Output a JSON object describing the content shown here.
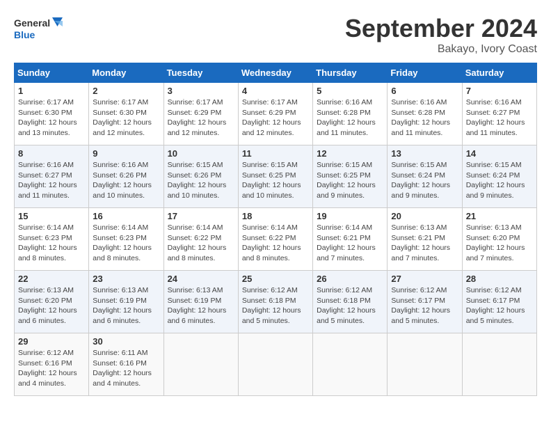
{
  "header": {
    "logo_line1": "General",
    "logo_line2": "Blue",
    "month_title": "September 2024",
    "location": "Bakayo, Ivory Coast"
  },
  "weekdays": [
    "Sunday",
    "Monday",
    "Tuesday",
    "Wednesday",
    "Thursday",
    "Friday",
    "Saturday"
  ],
  "weeks": [
    [
      {
        "day": 1,
        "sunrise": "6:17 AM",
        "sunset": "6:30 PM",
        "daylight": "12 hours and 13 minutes."
      },
      {
        "day": 2,
        "sunrise": "6:17 AM",
        "sunset": "6:30 PM",
        "daylight": "12 hours and 12 minutes."
      },
      {
        "day": 3,
        "sunrise": "6:17 AM",
        "sunset": "6:29 PM",
        "daylight": "12 hours and 12 minutes."
      },
      {
        "day": 4,
        "sunrise": "6:17 AM",
        "sunset": "6:29 PM",
        "daylight": "12 hours and 12 minutes."
      },
      {
        "day": 5,
        "sunrise": "6:16 AM",
        "sunset": "6:28 PM",
        "daylight": "12 hours and 11 minutes."
      },
      {
        "day": 6,
        "sunrise": "6:16 AM",
        "sunset": "6:28 PM",
        "daylight": "12 hours and 11 minutes."
      },
      {
        "day": 7,
        "sunrise": "6:16 AM",
        "sunset": "6:27 PM",
        "daylight": "12 hours and 11 minutes."
      }
    ],
    [
      {
        "day": 8,
        "sunrise": "6:16 AM",
        "sunset": "6:27 PM",
        "daylight": "12 hours and 11 minutes."
      },
      {
        "day": 9,
        "sunrise": "6:16 AM",
        "sunset": "6:26 PM",
        "daylight": "12 hours and 10 minutes."
      },
      {
        "day": 10,
        "sunrise": "6:15 AM",
        "sunset": "6:26 PM",
        "daylight": "12 hours and 10 minutes."
      },
      {
        "day": 11,
        "sunrise": "6:15 AM",
        "sunset": "6:25 PM",
        "daylight": "12 hours and 10 minutes."
      },
      {
        "day": 12,
        "sunrise": "6:15 AM",
        "sunset": "6:25 PM",
        "daylight": "12 hours and 9 minutes."
      },
      {
        "day": 13,
        "sunrise": "6:15 AM",
        "sunset": "6:24 PM",
        "daylight": "12 hours and 9 minutes."
      },
      {
        "day": 14,
        "sunrise": "6:15 AM",
        "sunset": "6:24 PM",
        "daylight": "12 hours and 9 minutes."
      }
    ],
    [
      {
        "day": 15,
        "sunrise": "6:14 AM",
        "sunset": "6:23 PM",
        "daylight": "12 hours and 8 minutes."
      },
      {
        "day": 16,
        "sunrise": "6:14 AM",
        "sunset": "6:23 PM",
        "daylight": "12 hours and 8 minutes."
      },
      {
        "day": 17,
        "sunrise": "6:14 AM",
        "sunset": "6:22 PM",
        "daylight": "12 hours and 8 minutes."
      },
      {
        "day": 18,
        "sunrise": "6:14 AM",
        "sunset": "6:22 PM",
        "daylight": "12 hours and 8 minutes."
      },
      {
        "day": 19,
        "sunrise": "6:14 AM",
        "sunset": "6:21 PM",
        "daylight": "12 hours and 7 minutes."
      },
      {
        "day": 20,
        "sunrise": "6:13 AM",
        "sunset": "6:21 PM",
        "daylight": "12 hours and 7 minutes."
      },
      {
        "day": 21,
        "sunrise": "6:13 AM",
        "sunset": "6:20 PM",
        "daylight": "12 hours and 7 minutes."
      }
    ],
    [
      {
        "day": 22,
        "sunrise": "6:13 AM",
        "sunset": "6:20 PM",
        "daylight": "12 hours and 6 minutes."
      },
      {
        "day": 23,
        "sunrise": "6:13 AM",
        "sunset": "6:19 PM",
        "daylight": "12 hours and 6 minutes."
      },
      {
        "day": 24,
        "sunrise": "6:13 AM",
        "sunset": "6:19 PM",
        "daylight": "12 hours and 6 minutes."
      },
      {
        "day": 25,
        "sunrise": "6:12 AM",
        "sunset": "6:18 PM",
        "daylight": "12 hours and 5 minutes."
      },
      {
        "day": 26,
        "sunrise": "6:12 AM",
        "sunset": "6:18 PM",
        "daylight": "12 hours and 5 minutes."
      },
      {
        "day": 27,
        "sunrise": "6:12 AM",
        "sunset": "6:17 PM",
        "daylight": "12 hours and 5 minutes."
      },
      {
        "day": 28,
        "sunrise": "6:12 AM",
        "sunset": "6:17 PM",
        "daylight": "12 hours and 5 minutes."
      }
    ],
    [
      {
        "day": 29,
        "sunrise": "6:12 AM",
        "sunset": "6:16 PM",
        "daylight": "12 hours and 4 minutes."
      },
      {
        "day": 30,
        "sunrise": "6:11 AM",
        "sunset": "6:16 PM",
        "daylight": "12 hours and 4 minutes."
      },
      null,
      null,
      null,
      null,
      null
    ]
  ]
}
